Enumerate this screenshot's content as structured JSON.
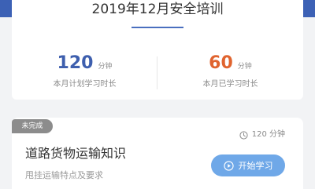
{
  "summary": {
    "title": "2019年12月安全培训",
    "planned": {
      "value": "120",
      "unit": "分钟",
      "label": "本月计划学习时长"
    },
    "studied": {
      "value": "60",
      "unit": "分钟",
      "label": "本月已学习时长"
    }
  },
  "course": {
    "status": "未完成",
    "duration": "120 分钟",
    "title": "道路货物运输知识",
    "description": "甩挂运输特点及要求",
    "start_label": "开始学习",
    "icons": {
      "duration": "clock-icon",
      "start": "play-icon"
    }
  },
  "colors": {
    "banner": "#3c61b5",
    "planned_value": "#3e5fae",
    "studied_value": "#e0642f",
    "start_button": "#6fa8e8",
    "status_badge": "#8c8c8c"
  }
}
